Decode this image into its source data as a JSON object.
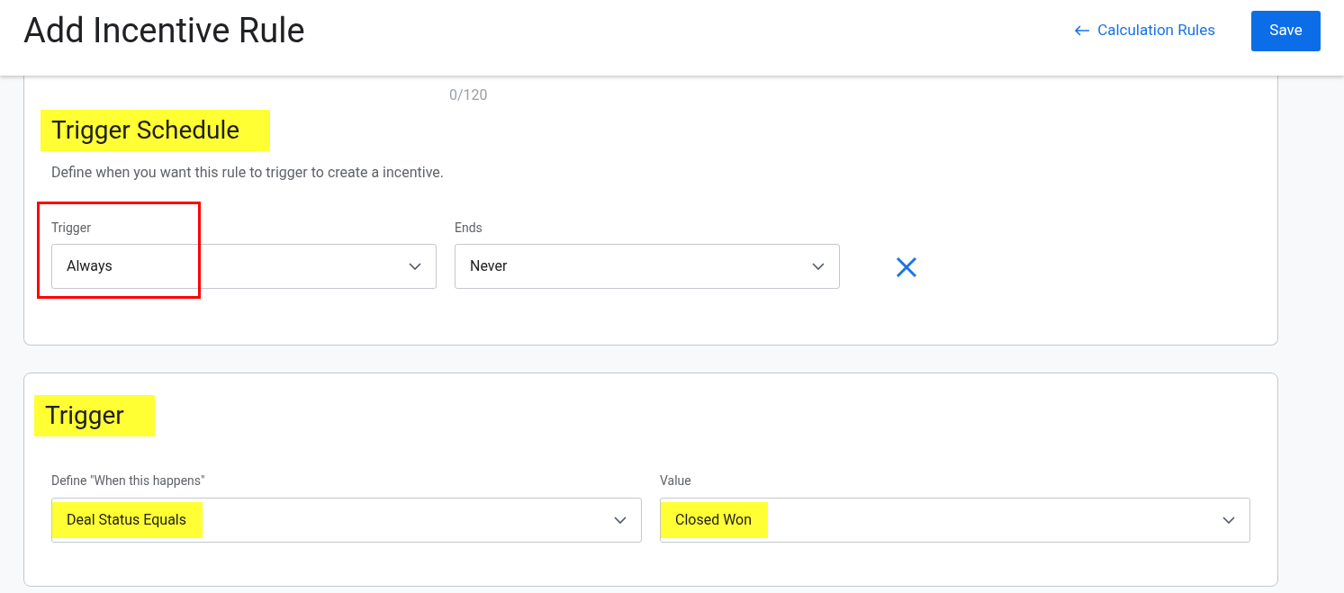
{
  "header": {
    "title": "Add Incentive Rule",
    "back_link": "Calculation Rules",
    "save_button": "Save"
  },
  "char_counter": "0/120",
  "sections": [
    {
      "title": "Trigger Schedule",
      "title_highlighted": true,
      "description": "Define when you want this rule to trigger to create a incentive.",
      "removable": true,
      "fields": [
        {
          "label": "Trigger",
          "value": "Always",
          "value_highlighted": false,
          "outlined": true
        },
        {
          "label": "Ends",
          "value": "Never",
          "value_highlighted": false,
          "outlined": false
        }
      ]
    },
    {
      "title": "Trigger",
      "title_highlighted": true,
      "removable": false,
      "fields": [
        {
          "label": "Define \"When this happens\"",
          "value": "Deal Status Equals",
          "value_highlighted": true,
          "outlined": false
        },
        {
          "label": "Value",
          "value": "Closed Won",
          "value_highlighted": true,
          "outlined": false
        }
      ]
    }
  ]
}
